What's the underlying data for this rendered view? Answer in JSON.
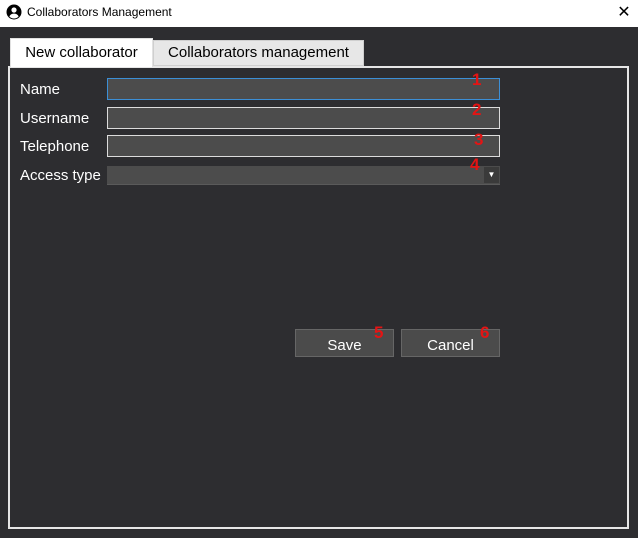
{
  "window": {
    "title": "Collaborators Management",
    "close_symbol": "✕"
  },
  "tabs": [
    {
      "label": "New collaborator",
      "active": true
    },
    {
      "label": "Collaborators management",
      "active": false
    }
  ],
  "form": {
    "name_label": "Name",
    "name_value": "",
    "username_label": "Username",
    "username_value": "",
    "telephone_label": "Telephone",
    "telephone_value": "",
    "access_type_label": "Access type",
    "access_type_value": ""
  },
  "buttons": {
    "save_label": "Save",
    "cancel_label": "Cancel"
  },
  "markers": [
    "1",
    "2",
    "3",
    "4",
    "5",
    "6"
  ],
  "colors": {
    "background": "#2d2d30",
    "field": "#4c4c4c",
    "marker": "#e41414"
  }
}
